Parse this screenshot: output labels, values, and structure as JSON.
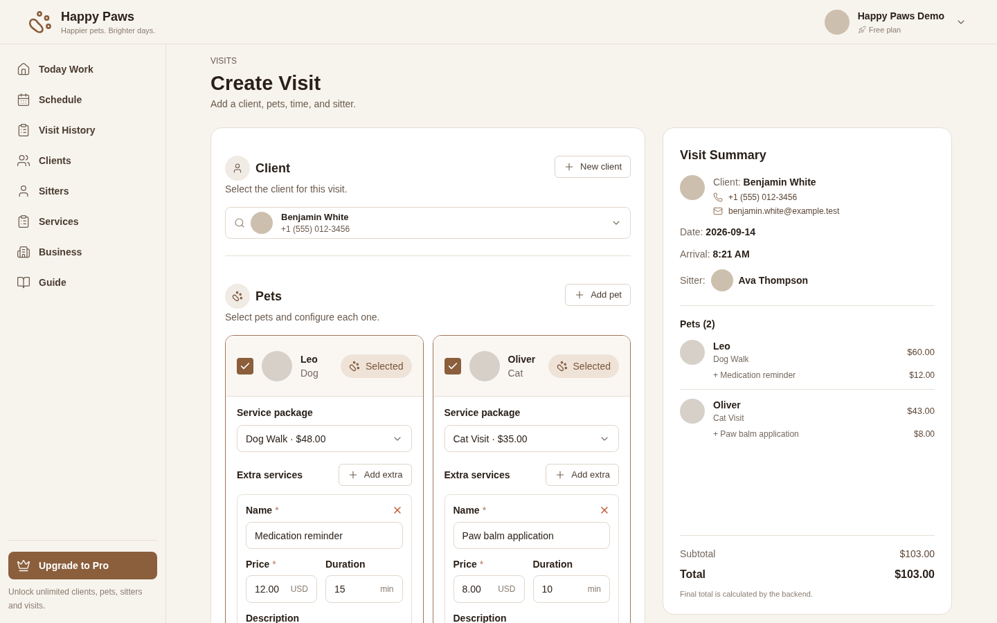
{
  "app": {
    "name": "Happy Paws",
    "tagline": "Happier pets. Brighter days."
  },
  "account": {
    "name": "Happy Paws Demo",
    "plan": "Free plan"
  },
  "sidebar": {
    "items": [
      "Today Work",
      "Schedule",
      "Visit History",
      "Clients",
      "Sitters",
      "Services",
      "Business",
      "Guide"
    ],
    "upgrade": {
      "label": "Upgrade to Pro",
      "note": "Unlock unlimited clients, pets, sitters and visits."
    }
  },
  "page": {
    "eyebrow": "VISITS",
    "title": "Create Visit",
    "subtitle": "Add a client, pets, time, and sitter."
  },
  "client_section": {
    "title": "Client",
    "subtitle": "Select the client for this visit.",
    "button": "New client",
    "client": {
      "name": "Benjamin White",
      "phone": "+1 (555) 012-3456"
    }
  },
  "pets_section": {
    "title": "Pets",
    "subtitle": "Select pets and configure each one.",
    "button": "Add pet",
    "pets": [
      {
        "name": "Leo",
        "type": "Dog",
        "checked": true,
        "badge": "Selected",
        "service_label": "Service package",
        "service": "Dog Walk · $48.00",
        "extras_label": "Extra services",
        "add_extra": "Add extra",
        "extras": [
          {
            "name": {
              "label": "Name",
              "mark": "*",
              "value": "Medication reminder"
            },
            "price": {
              "label": "Price",
              "mark": "*",
              "value": "12.00",
              "unit": "USD"
            },
            "duration": {
              "label": "Duration",
              "value": "15",
              "unit": "min"
            },
            "description_label": "Description"
          }
        ]
      },
      {
        "name": "Oliver",
        "type": "Cat",
        "checked": true,
        "badge": "Selected",
        "service_label": "Service package",
        "service": "Cat Visit · $35.00",
        "extras_label": "Extra services",
        "add_extra": "Add extra",
        "extras": [
          {
            "name": {
              "label": "Name",
              "mark": "*",
              "value": "Paw balm application"
            },
            "price": {
              "label": "Price",
              "mark": "*",
              "value": "8.00",
              "unit": "USD"
            },
            "duration": {
              "label": "Duration",
              "value": "10",
              "unit": "min"
            },
            "description_label": "Description"
          }
        ]
      }
    ]
  },
  "summary": {
    "title": "Visit Summary",
    "client": {
      "label": "Client:",
      "name": "Benjamin White",
      "phone": "+1 (555) 012-3456",
      "email": "benjamin.white@example.test"
    },
    "date": {
      "label": "Date:",
      "value": "2026-09-14"
    },
    "arrival": {
      "label": "Arrival:",
      "value": "8:21 AM"
    },
    "sitter": {
      "label": "Sitter:",
      "name": "Ava Thompson"
    },
    "pets_title": "Pets (2)",
    "pets": [
      {
        "name": "Leo",
        "service": "Dog Walk",
        "price": "$60.00",
        "extras": [
          {
            "name": "+ Medication reminder",
            "price": "$12.00"
          }
        ]
      },
      {
        "name": "Oliver",
        "service": "Cat Visit",
        "price": "$43.00",
        "extras": [
          {
            "name": "+ Paw balm application",
            "price": "$8.00"
          }
        ]
      }
    ],
    "subtotal": {
      "label": "Subtotal",
      "value": "$103.00"
    },
    "total": {
      "label": "Total",
      "value": "$103.00"
    },
    "note": "Final total is calculated by the backend."
  }
}
